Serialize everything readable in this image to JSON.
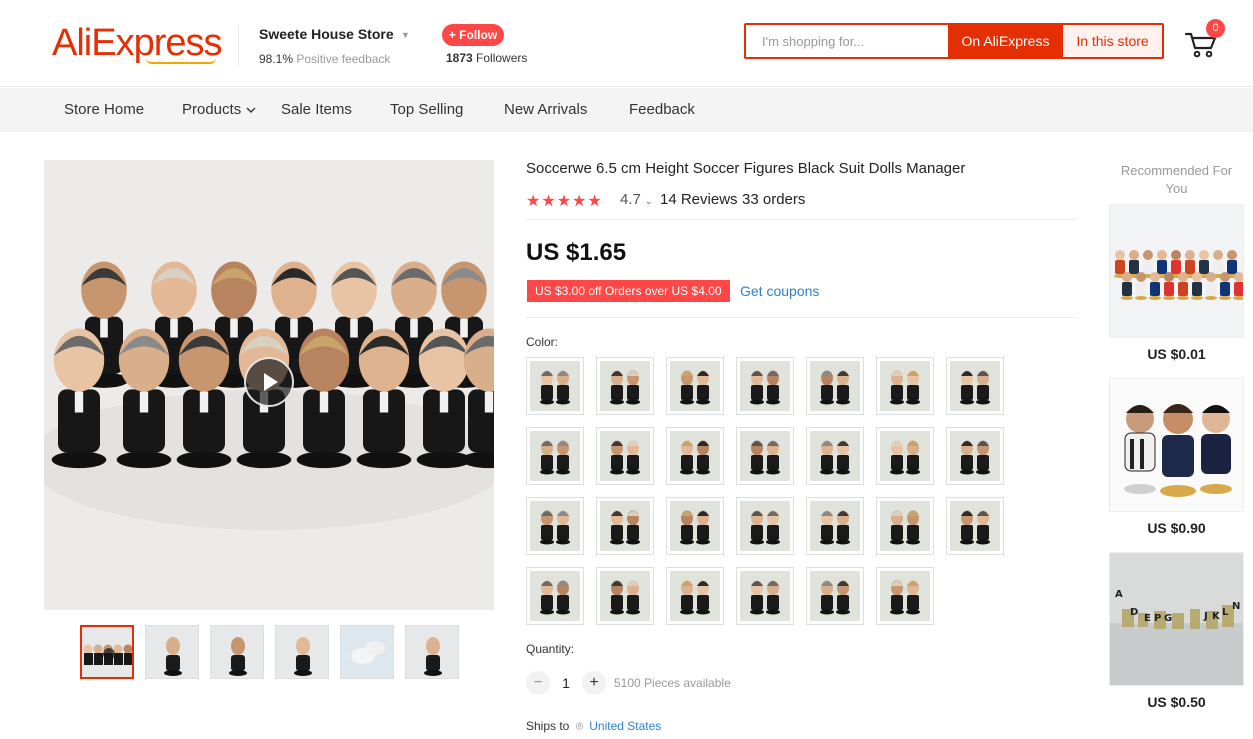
{
  "header": {
    "logo_text": "AliExpress",
    "store_name": "Sweete House Store",
    "feedback_percent": "98.1%",
    "feedback_label": "Positive feedback",
    "follow_label": "+ Follow",
    "followers_count": "1873",
    "followers_label": "Followers",
    "search_placeholder": "I'm shopping for...",
    "search_ali_label": "On AliExpress",
    "search_store_label": "In this store",
    "cart_count": "0"
  },
  "nav": {
    "items": [
      "Store Home",
      "Products",
      "Sale Items",
      "Top Selling",
      "New Arrivals",
      "Feedback"
    ]
  },
  "product": {
    "title": "Soccerwe 6.5 cm Height Soccer Figures Black Suit Dolls Manager",
    "stars": "★★★★★",
    "rating": "4.7",
    "reviews": "14 Reviews",
    "orders": "33 orders",
    "price": "US $1.65",
    "coupon": "US $3.00 off Orders over US $4.00",
    "get_coupons": "Get coupons",
    "color_label": "Color:",
    "swatch_count": 27,
    "quantity_label": "Quantity:",
    "quantity_value": "1",
    "available": "5100 Pieces available",
    "ships_to_label": "Ships to",
    "ships_to_country": "United States"
  },
  "gallery": {
    "thumbnail_count": 6,
    "active_index": 0
  },
  "recommended": {
    "title": "Recommended For You",
    "items": [
      {
        "price": "US $0.01"
      },
      {
        "price": "US $0.90"
      },
      {
        "price": "US $0.50"
      }
    ]
  },
  "colors": {
    "accent": "#e62e04",
    "follow": "#ff4747",
    "link": "#2e82c5"
  }
}
